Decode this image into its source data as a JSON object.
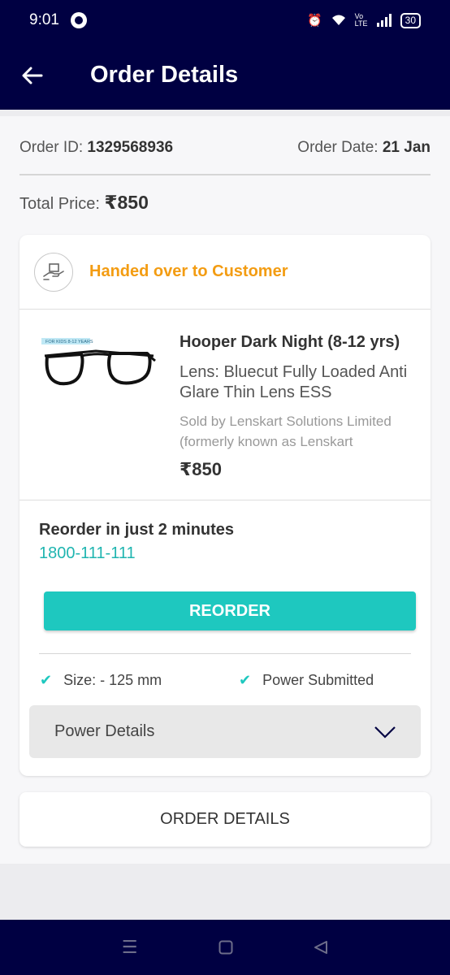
{
  "status_bar": {
    "time": "9:01",
    "battery": "30",
    "network": "Vo LTE"
  },
  "app_bar": {
    "title": "Order Details"
  },
  "order": {
    "id_label": "Order ID:",
    "id_value": "1329568936",
    "date_label": "Order Date:",
    "date_value": "21 Jan",
    "total_label": "Total Price:",
    "total_value": "₹850"
  },
  "status": {
    "text": "Handed over to Customer",
    "color": "#f39c12"
  },
  "product": {
    "name": "Hooper Dark Night (8-12 yrs)",
    "lens": "Lens: Bluecut Fully Loaded Anti Glare Thin Lens ESS",
    "seller": "Sold by Lenskart Solutions Limited (formerly known as Lenskart",
    "price": "₹850",
    "image_tag": "FOR KIDS 8-12 YEARS"
  },
  "reorder": {
    "title": "Reorder in just 2 minutes",
    "phone": "1800-111-111",
    "button": "REORDER"
  },
  "checks": {
    "size": "Size: - 125 mm",
    "power": "Power Submitted"
  },
  "power_details": {
    "label": "Power Details"
  },
  "order_details_button": "ORDER DETAILS",
  "colors": {
    "header": "#000042",
    "accent": "#1ec8bf",
    "status": "#f39c12"
  }
}
